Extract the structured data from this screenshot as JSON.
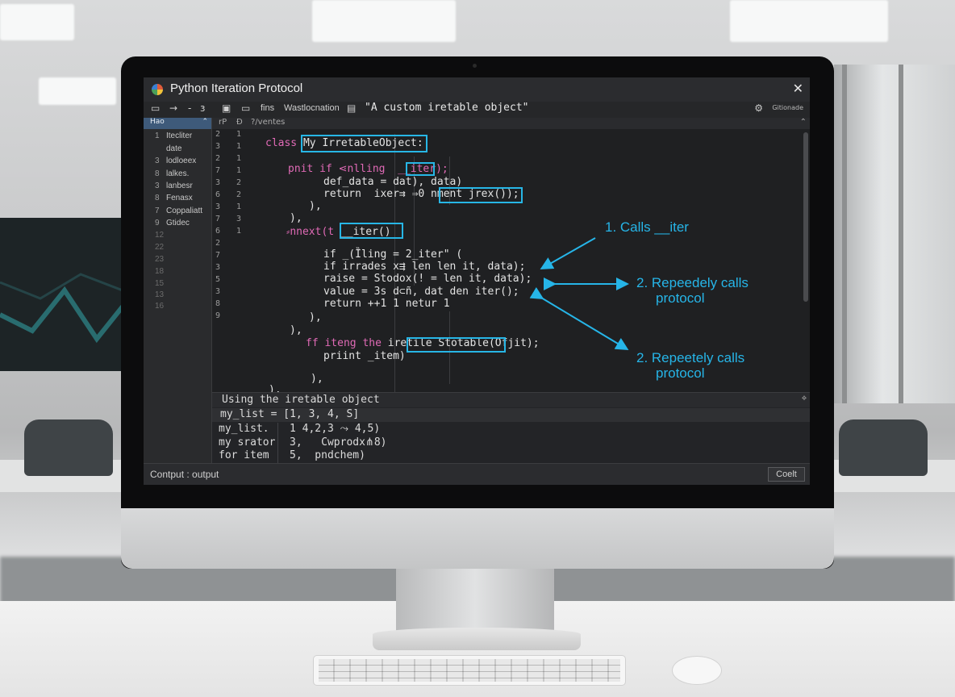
{
  "window": {
    "title": "Python Iteration Protocol"
  },
  "toolbar": {
    "fins_label": "fins",
    "menu_label": "Wastlocnation",
    "document_title": "\"A custom iretable object\"",
    "right_label": "Gitionade"
  },
  "sidebar": {
    "header": "Hao",
    "items": [
      {
        "num": "1",
        "label": "Itecliter"
      },
      {
        "num": "",
        "label": "date"
      },
      {
        "num": "3",
        "label": "lodloeex"
      },
      {
        "num": "8",
        "label": "lalkes."
      },
      {
        "num": "3",
        "label": "lanbesr"
      },
      {
        "num": "8",
        "label": "Fenasx"
      },
      {
        "num": "7",
        "label": "Coppaliatt"
      },
      {
        "num": "9",
        "label": "Gtidec"
      }
    ],
    "extra_numbers": [
      "12",
      "22",
      "23",
      "18",
      "15",
      "13",
      "16"
    ]
  },
  "editor": {
    "header_left": "rP",
    "header_mid": "Ð",
    "header_file": "?/ventes",
    "gutter_a": [
      "2",
      "3",
      "2",
      "7",
      "3",
      "6",
      "3",
      "7",
      "6",
      "2",
      "7",
      "3",
      "5",
      "3",
      "8",
      "9"
    ],
    "gutter_b": [
      "1",
      "1",
      "1",
      "1",
      "2",
      "2",
      "1",
      "3",
      "1"
    ],
    "lines": {
      "l1_kw": "class",
      "l1_name": "My IrretableObject:",
      "l2": "pnit if ⋖nlling  __iter);",
      "l3": "def_data = dat), data)",
      "l4": "return  ixer⇉ ⇒0 nment jrex());",
      "l5": "),",
      "l6": "),",
      "l7_kw": "⸗nnext(t",
      "l7_name": "__iter()",
      "l8": "if _(Ȉling = 2_iter\" (",
      "l9": "if irrades x⇶ len len it, data);",
      "l10": "raise = Stodox(! = len it, data);",
      "l11": "value = 3s d⊂ñ, dat den iter();",
      "l12": "return ++1 1 netur 1",
      "l13": "),",
      "l14": "),",
      "l15_kw": "ff iteng the",
      "l15_rest": "ire⁠tile Stotable(Ofjit);",
      "l16": "priint _item)",
      "l17": "),",
      "l18": ")."
    }
  },
  "annotations": {
    "a1": "1.  Calls __iter",
    "a2_line1": "2.  Repeedely calls",
    "a2_line2": "protocol",
    "a3_line1": "2.  Repeetely calls",
    "a3_line2": "protocol",
    "color": "#26b5e8"
  },
  "output": {
    "header": "Using the iretable object",
    "row1": "my_list = [1, 3, 4, S]",
    "row2_left": "my_list.",
    "row2_right": "1 4,2,3 ⤳ 4,5)",
    "row3_left": "my srator",
    "row3_right": "3,   Cwprodx⋔8)",
    "row4_left": "for item",
    "row4_right": "5,  pndchem)"
  },
  "status": {
    "text": "Contput : output",
    "button": "Coelt"
  },
  "colors": {
    "accent": "#27b6e6",
    "keyword": "#e06ab6",
    "editor_bg": "#1f2022"
  }
}
